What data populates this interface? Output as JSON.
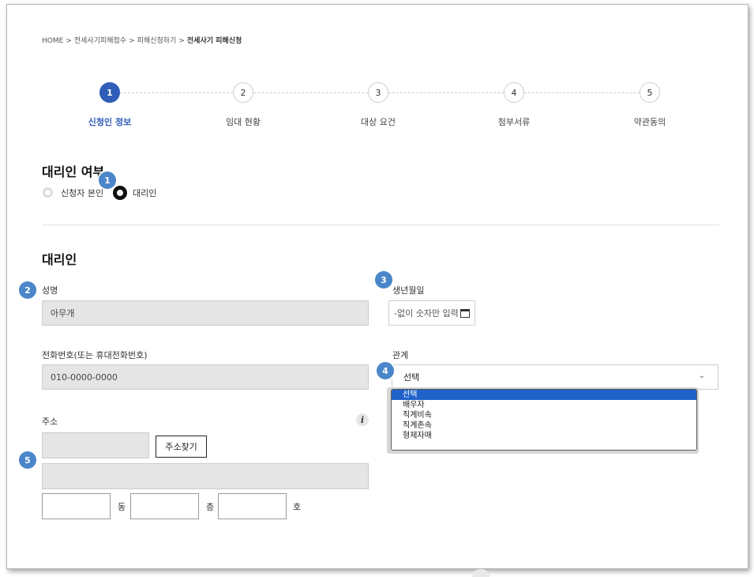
{
  "breadcrumb": {
    "items": [
      "HOME",
      "전세사기피해접수",
      "피해신청하기",
      "전세사기 피해신청"
    ],
    "separator": ">"
  },
  "steps": [
    {
      "number": "1",
      "label": "신청인 정보",
      "active": true
    },
    {
      "number": "2",
      "label": "임대 현황",
      "active": false
    },
    {
      "number": "3",
      "label": "대상 요건",
      "active": false
    },
    {
      "number": "4",
      "label": "첨부서류",
      "active": false
    },
    {
      "number": "5",
      "label": "약관동의",
      "active": false
    }
  ],
  "proxy_section": {
    "title": "대리인 여부",
    "options": [
      {
        "label": "신청자 본인",
        "checked": false
      },
      {
        "label": "대리인",
        "checked": true
      }
    ]
  },
  "agent_section": {
    "title": "대리인",
    "name": {
      "label": "성명",
      "value": "아무개"
    },
    "birth": {
      "label": "생년월일",
      "placeholder": "-없이 숫자만 입력"
    },
    "phone": {
      "label": "전화번호(또는 휴대전화번호)",
      "value": "010-0000-0000"
    },
    "relation": {
      "label": "관계",
      "selected": "선택",
      "options": [
        "선택",
        "배우자",
        "직계비속",
        "직계존속",
        "형제자매"
      ]
    },
    "address": {
      "label": "주소",
      "search_button": "주소찾기",
      "units": [
        "동",
        "층",
        "호"
      ]
    }
  },
  "info_icon": "info-icon",
  "callouts": [
    "1",
    "2",
    "3",
    "4",
    "5"
  ],
  "colors": {
    "accent": "#2f5db8",
    "callout": "#4a86c9",
    "dropdown_selected": "#1f62c9",
    "field_gray": "#e5e5e5"
  }
}
